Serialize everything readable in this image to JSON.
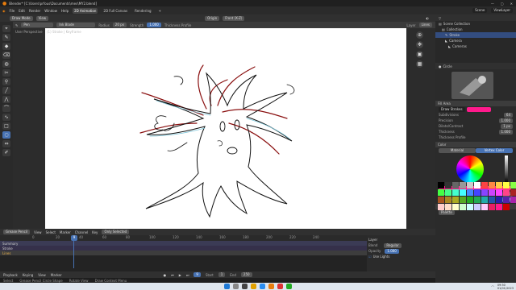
{
  "window": {
    "title": "Blender* [C:\\Users\\prfous\\Documents\\mes\\MY2.blend]",
    "controls": [
      "—",
      "▢",
      "✕"
    ]
  },
  "menu": {
    "items": [
      "File",
      "Edit",
      "Render",
      "Window",
      "Help"
    ],
    "workspace_tabs": [
      "2D Animation",
      "2D Full Canvas",
      "Rendering"
    ],
    "scene": "Scene",
    "view_layer": "ViewLayer"
  },
  "header": {
    "mode": "Draw Mode",
    "object": "Origin",
    "stroke": "Front (X-Z)",
    "placement_label": "Surface"
  },
  "tool_settings": {
    "brush": "Pen",
    "material": "Ink Blade",
    "radius_label": "Radius",
    "radius_value": "20 px",
    "strength_label": "Strength",
    "strength_value": "1.000",
    "thickness_profile": "Thickness Profile",
    "layer_label": "Layer",
    "layer_value": "Lines"
  },
  "viewport": {
    "view_label": "User Perspective",
    "object_label": "(1) Stroke | Keyframe"
  },
  "outliner": {
    "title": "Scene Collection",
    "items": [
      "Collection",
      "Stroke",
      "Camera",
      "Cameras"
    ]
  },
  "properties": {
    "object": "Circle",
    "fill_area": "Fill Area",
    "draw_strokes": "Draw Strokes",
    "subdivisions": "Subdivisions",
    "subdivisions_value": "64",
    "precision_label": "Precision",
    "precision_value": "1.000",
    "dilate_label": "Dilate/Contract",
    "dilate_value": "1 px",
    "thickness_label": "Thickness",
    "thickness_value": "1.000",
    "thickness_profile": "Thickness Profile",
    "color_label": "Color",
    "tab_material": "Material",
    "tab_vertex": "Vertex Color",
    "mode": "Mode",
    "mode_value": "Mix",
    "mix_factor": "Mix Factor",
    "mix_factor_value": "1.000",
    "palettes": "Palettes",
    "palette_name": "Palette"
  },
  "timeline": {
    "editor": "Grease Pencil",
    "menus": [
      "View",
      "Select",
      "Marker",
      "Channel",
      "Key"
    ],
    "mode": "Only Selected",
    "ticks": [
      "0",
      "20",
      "40",
      "60",
      "80",
      "100",
      "120",
      "140",
      "160",
      "180",
      "200",
      "220",
      "240"
    ],
    "current_frame": "9",
    "tracks": [
      "Summary",
      "Stroke",
      "Lines"
    ],
    "layer_panel_title": "Layer",
    "blend_label": "Blend",
    "blend_value": "Regular",
    "opacity_label": "Opacity",
    "opacity_value": "1.000",
    "lights_label": "Use Lights"
  },
  "playback": {
    "playback": "Playback",
    "keying": "Keying",
    "view": "View",
    "marker": "Marker",
    "start": "1",
    "end": "250",
    "start_label": "Start",
    "end_label": "End"
  },
  "status": {
    "items": [
      "Select",
      "Grease Pencil Circle Shape",
      "Rotate View",
      "Draw Context Menu"
    ]
  },
  "taskbar": {
    "time": "09:50",
    "date": "01/01/2023"
  },
  "colors": {
    "accent": "#4772b3",
    "active_color": "#ff1a8c"
  }
}
